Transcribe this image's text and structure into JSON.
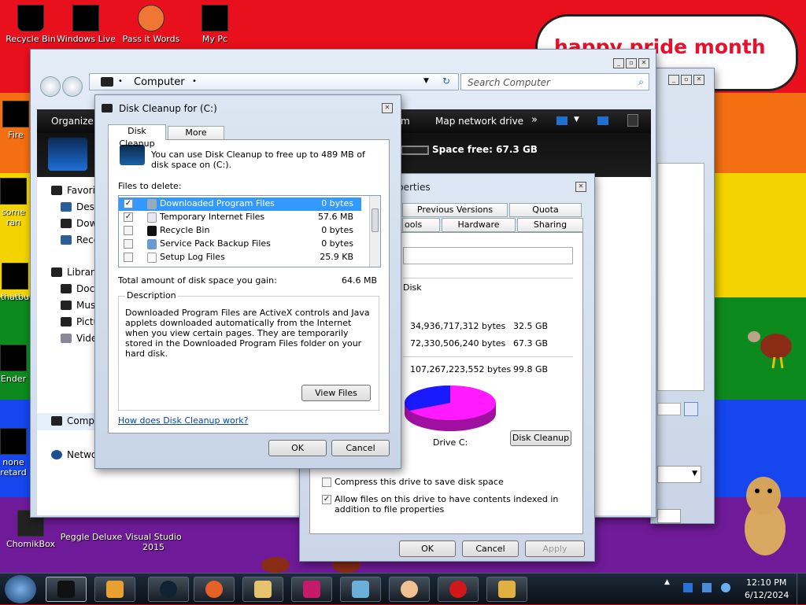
{
  "desktop": {
    "banner_text": "happy pride month",
    "icons": [
      {
        "label": "Recycle Bin"
      },
      {
        "label": "Windows Live"
      },
      {
        "label": "Pass it Words"
      },
      {
        "label": "My Pc"
      },
      {
        "label": "Fire"
      },
      {
        "label": "some"
      },
      {
        "label": "ran"
      },
      {
        "label": "thatbu"
      },
      {
        "label": "Ender"
      },
      {
        "label": "none"
      },
      {
        "label": "retard"
      },
      {
        "label": "ChomikBox"
      },
      {
        "label": "Peggle Deluxe"
      },
      {
        "label": "Visual Studio 2015"
      }
    ]
  },
  "explorer": {
    "address": "Computer",
    "search_placeholder": "Search Computer",
    "toolbar": {
      "organize": "Organize",
      "map_drive": "Map network drive",
      "more": "»",
      "partial": "m"
    },
    "space_free": "Space free: 67.3 GB",
    "nav": {
      "favorites": "Favori",
      "desktop": "Desk",
      "downloads": "Dow",
      "recent": "Rece",
      "libraries": "Librari",
      "documents": "Docu",
      "music": "Mus",
      "pictures": "Pictu",
      "videos": "Vide",
      "computer": "Comp",
      "network": "Netwo"
    }
  },
  "disk_cleanup": {
    "title": "Disk Cleanup for  (C:)",
    "tabs": [
      "Disk Cleanup",
      "More Options"
    ],
    "intro": "You can use Disk Cleanup to free up to 489 MB of disk space on  (C:).",
    "files_label": "Files to delete:",
    "files": [
      {
        "name": "Downloaded Program Files",
        "size": "0 bytes",
        "checked": true
      },
      {
        "name": "Temporary Internet Files",
        "size": "57.6 MB",
        "checked": true
      },
      {
        "name": "Recycle Bin",
        "size": "0 bytes",
        "checked": false
      },
      {
        "name": "Service Pack Backup Files",
        "size": "0 bytes",
        "checked": false
      },
      {
        "name": "Setup Log Files",
        "size": "25.9 KB",
        "checked": false
      }
    ],
    "total_label": "Total amount of disk space you gain:",
    "total_value": "64.6 MB",
    "description_heading": "Description",
    "description": "Downloaded Program Files are ActiveX controls and Java applets downloaded automatically from the Internet when you view certain pages. They are temporarily stored in the Downloaded Program Files folder on your hard disk.",
    "view_files": "View Files",
    "help_link": "How does Disk Cleanup work?",
    "ok": "OK",
    "cancel": "Cancel"
  },
  "properties": {
    "title_partial": "perties",
    "tabs_row1": [
      "Previous Versions",
      "Quota"
    ],
    "tabs_row2": [
      "ools",
      "Hardware",
      "Sharing"
    ],
    "type": "Disk",
    "used_bytes": "34,936,717,312 bytes",
    "used_gb": "32.5 GB",
    "free_bytes": "72,330,506,240 bytes",
    "free_gb": "67.3 GB",
    "capacity_bytes": "107,267,223,552 bytes",
    "capacity_gb": "99.8 GB",
    "drive_label": "Drive C:",
    "disk_cleanup": "Disk Cleanup",
    "compress": "Compress this drive to save disk space",
    "compress_checked": false,
    "index": "Allow files on this drive to have contents indexed in addition to file properties",
    "index_checked": true,
    "ok": "OK",
    "cancel": "Cancel",
    "apply": "Apply",
    "pie_used_fraction": 0.325,
    "colors": {
      "used": "#1a1aff",
      "free": "#ff1aff"
    }
  },
  "taskbar": {
    "time": "12:10 PM",
    "date": "6/12/2024"
  }
}
